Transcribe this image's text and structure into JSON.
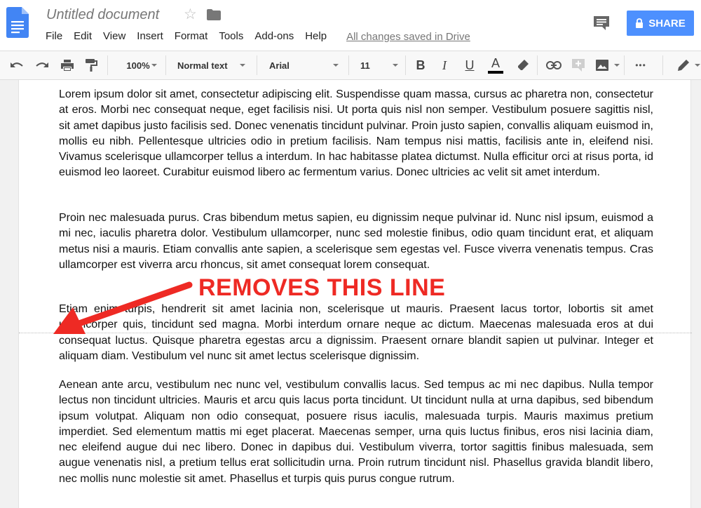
{
  "header": {
    "title": "Untitled document",
    "menu": [
      "File",
      "Edit",
      "View",
      "Insert",
      "Format",
      "Tools",
      "Add-ons",
      "Help"
    ],
    "saved_status": "All changes saved in Drive",
    "share_label": "SHARE"
  },
  "toolbar": {
    "zoom": "100%",
    "style": "Normal text",
    "font": "Arial",
    "font_size": "11",
    "bold_label": "B",
    "italic_label": "I",
    "underline_label": "U",
    "text_color_label": "A",
    "more_label": "•••"
  },
  "icons": {
    "app": "docs-icon",
    "star": "star-icon",
    "folder": "folder-icon",
    "comment": "comment-icon",
    "lock": "lock-icon",
    "undo": "undo-icon",
    "redo": "redo-icon",
    "print": "print-icon",
    "paint_format": "paint-format-icon",
    "highlight": "highlight-icon",
    "link": "link-icon",
    "add_comment": "add-comment-icon",
    "image": "image-icon",
    "editing_mode": "pencil-icon"
  },
  "colors": {
    "share_button": "#4d90fe",
    "annotation": "#ee2a24",
    "docs_blue": "#4285f4"
  },
  "document": {
    "paragraphs": [
      "Lorem ipsum dolor sit amet, consectetur adipiscing elit. Suspendisse quam massa, cursus ac pharetra non, consectetur at eros. Morbi nec consequat neque, eget facilisis nisi. Ut porta quis nisl non semper. Vestibulum posuere sagittis nisl, sit amet dapibus justo facilisis sed. Donec venenatis tincidunt pulvinar. Proin justo sapien, convallis aliquam euismod in, mollis eu nibh. Pellentesque ultricies odio in pretium facilisis. Nam tempus nisi mattis, facilisis ante in, eleifend nisi. Vivamus scelerisque ullamcorper tellus a interdum. In hac habitasse platea dictumst. Nulla efficitur orci at risus porta, id euismod leo laoreet. Curabitur euismod libero ac fermentum varius. Donec ultricies ac velit sit amet interdum.",
      "Proin nec malesuada purus. Cras bibendum metus sapien, eu dignissim neque pulvinar id. Nunc nisl ipsum, euismod a mi nec, iaculis pharetra dolor. Vestibulum ullamcorper, nunc sed molestie finibus, odio quam tincidunt erat, et aliquam metus nisi a mauris. Etiam convallis ante sapien, a scelerisque sem egestas vel. Fusce viverra venenatis tempus. Cras ullamcorper est viverra arcu rhoncus, sit amet consequat lorem consequat.",
      "Etiam enim turpis, hendrerit sit amet lacinia non, scelerisque ut mauris. Praesent lacus tortor, lobortis sit amet ullamcorper quis, tincidunt sed magna. Morbi interdum ornare neque ac dictum. Maecenas malesuada eros at dui consequat luctus. Quisque pharetra egestas arcu a dignissim. Praesent ornare blandit sapien ut pulvinar. Integer et aliquam diam. Vestibulum vel nunc sit amet lectus scelerisque dignissim.",
      "Aenean ante arcu, vestibulum nec nunc vel, vestibulum convallis lacus. Sed tempus ac mi nec dapibus. Nulla tempor lectus non tincidunt ultricies. Mauris et arcu quis lacus porta tincidunt. Ut tincidunt nulla at urna dapibus, sed bibendum ipsum volutpat. Aliquam non odio consequat, posuere risus iaculis, malesuada turpis. Mauris maximus pretium imperdiet. Sed elementum mattis mi eget placerat. Maecenas semper, urna quis luctus finibus, eros nisi lacinia diam, nec eleifend augue dui nec libero. Donec in dapibus dui. Vestibulum viverra, tortor sagittis finibus malesuada, sem augue venenatis nisl, a pretium tellus erat sollicitudin urna. Proin rutrum tincidunt nisl. Phasellus gravida blandit libero, nec mollis nunc molestie sit amet. Phasellus et turpis quis purus congue rutrum."
    ]
  },
  "annotation": {
    "text": "REMOVES THIS LINE"
  }
}
